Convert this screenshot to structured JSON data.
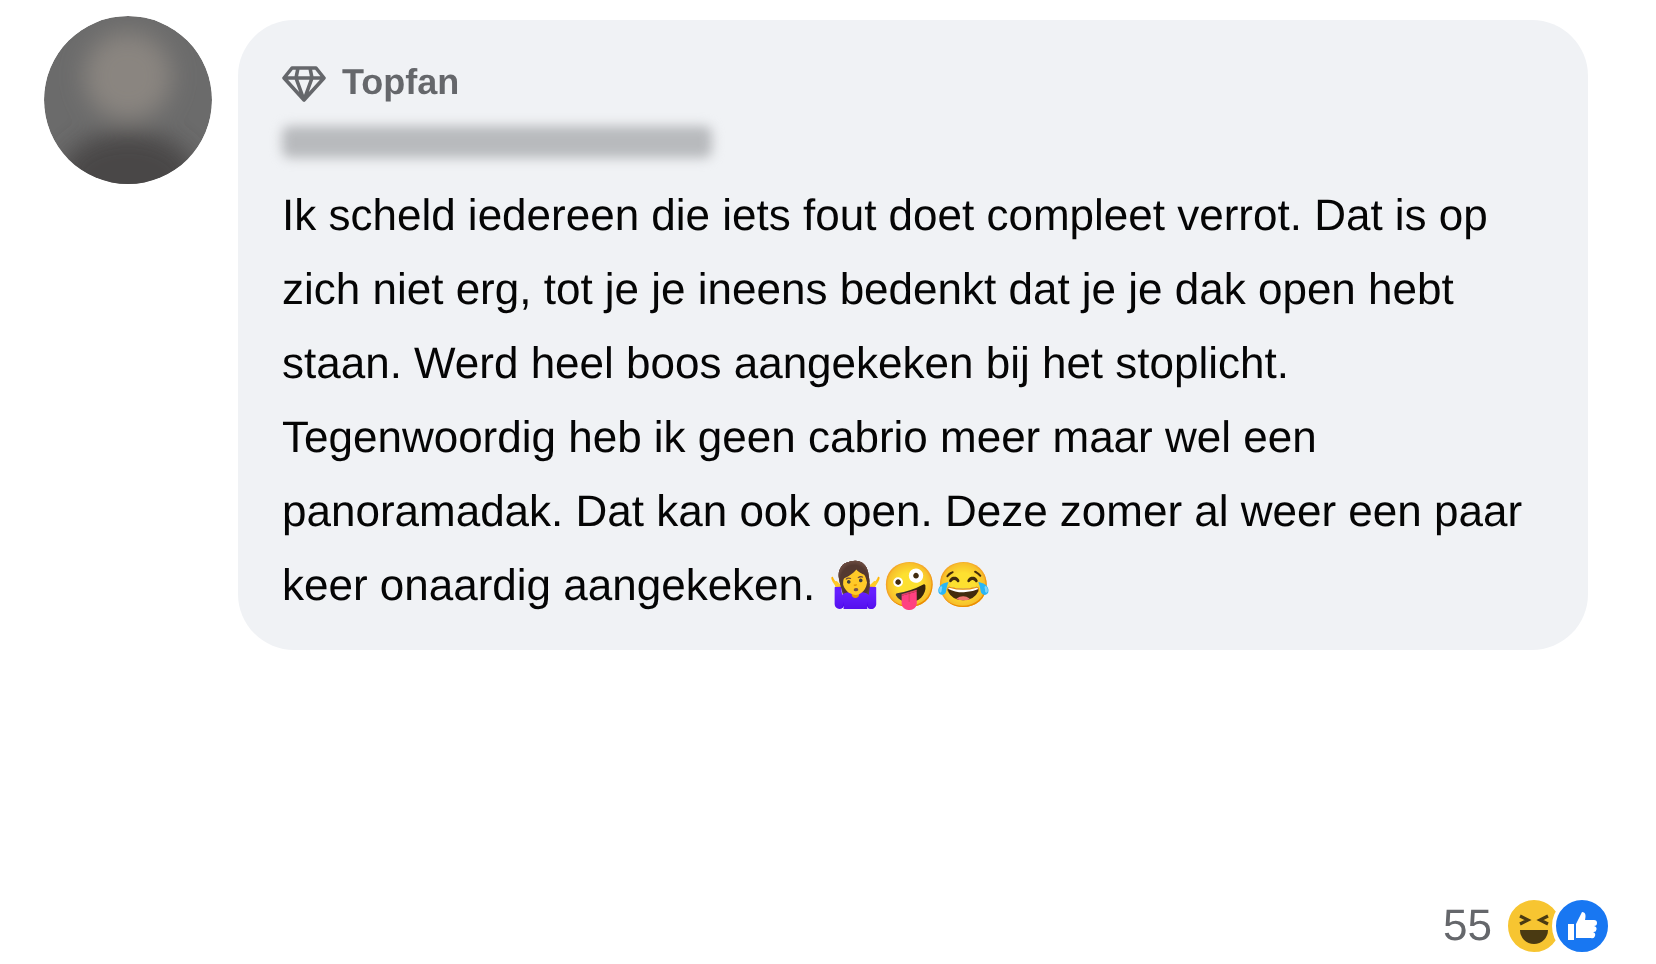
{
  "comment": {
    "badge": "Topfan",
    "text": "Ik scheld iedereen die iets fout doet compleet verrot. Dat is op zich niet erg, tot je je ineens bedenkt dat je je dak open hebt staan. Werd heel boos aangekeken bij het stoplicht. Tegenwoordig heb ik geen cabrio meer maar wel een panoramadak. Dat kan ook open. Deze zomer al weer een paar keer onaardig aangekeken. 🤷‍♀️🤪😂"
  },
  "reactions": {
    "count": "55"
  }
}
